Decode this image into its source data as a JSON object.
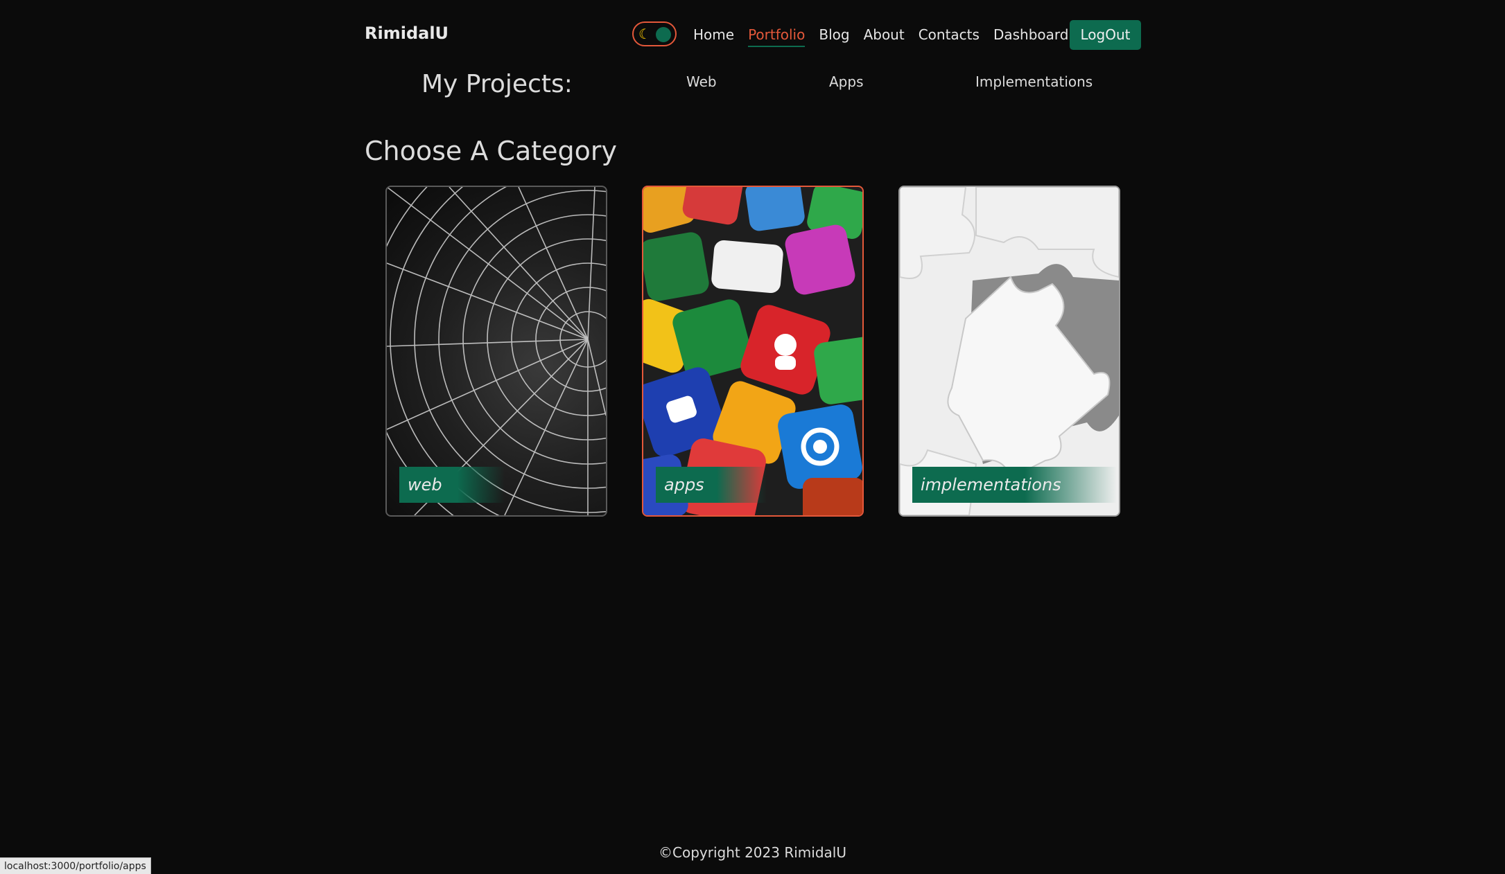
{
  "brand": "RimidalU",
  "theme_toggle": {
    "icon": "moon-icon",
    "glyph": "☾"
  },
  "nav": {
    "items": [
      "Home",
      "Portfolio",
      "Blog",
      "About",
      "Contacts",
      "Dashboard"
    ],
    "active": "Portfolio",
    "logout_label": "LogOut"
  },
  "projects": {
    "title": "My Projects:",
    "tabs": [
      "Web",
      "Apps",
      "Implementations"
    ]
  },
  "category_title": "Choose A Category",
  "cards": [
    {
      "label": "web",
      "image": "spider-web-image"
    },
    {
      "label": "apps",
      "image": "app-icons-image"
    },
    {
      "label": "implementations",
      "image": "puzzle-pieces-image"
    }
  ],
  "footer": "©Copyright 2023 RimidalU",
  "status_url": "localhost:3000/portfolio/apps",
  "colors": {
    "accent_green": "#0d6b4f",
    "accent_orange": "#e4583a",
    "background": "#0b0b0b"
  }
}
